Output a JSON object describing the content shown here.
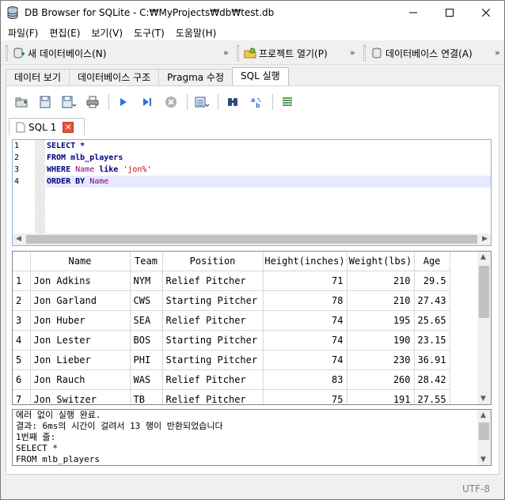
{
  "window": {
    "title": "DB Browser for SQLite - C:₩MyProjects₩db₩test.db"
  },
  "menu": [
    "파일(F)",
    "편집(E)",
    "보기(V)",
    "도구(T)",
    "도움말(H)"
  ],
  "toolbar": {
    "new_db": "새 데이터베이스(N)",
    "open_project": "프로젝트 열기(P)",
    "db_connect": "데이터베이스 연결(A)"
  },
  "tabs": [
    "데이터 보기",
    "데이터베이스 구조",
    "Pragma 수정",
    "SQL 실행"
  ],
  "active_tab": "SQL 실행",
  "sql_tab": {
    "label": "SQL 1"
  },
  "editor": {
    "line_numbers": [
      "1",
      "2",
      "3",
      "4"
    ],
    "lines": [
      [
        {
          "t": "SELECT",
          "c": "kw"
        },
        {
          "t": " *",
          "c": "kw"
        }
      ],
      [
        {
          "t": "FROM",
          "c": "kw"
        },
        {
          "t": " mlb_players",
          "c": "kw"
        }
      ],
      [
        {
          "t": "WHERE",
          "c": "kw"
        },
        {
          "t": " Name",
          "c": "id"
        },
        {
          "t": " like",
          "c": "kw"
        },
        {
          "t": " 'jon%'",
          "c": "str"
        }
      ],
      [
        {
          "t": "ORDER BY",
          "c": "kw"
        },
        {
          "t": " Name",
          "c": "id"
        }
      ]
    ]
  },
  "results": {
    "columns": [
      "Name",
      "Team",
      "Position",
      "Height(inches)",
      "Weight(lbs)",
      "Age"
    ],
    "rows": [
      [
        "1",
        "Jon Adkins",
        "NYM",
        "Relief Pitcher",
        "71",
        "210",
        "29.5"
      ],
      [
        "2",
        "Jon Garland",
        "CWS",
        "Starting Pitcher",
        "78",
        "210",
        "27.43"
      ],
      [
        "3",
        "Jon Huber",
        "SEA",
        "Relief Pitcher",
        "74",
        "195",
        "25.65"
      ],
      [
        "4",
        "Jon Lester",
        "BOS",
        "Starting Pitcher",
        "74",
        "190",
        "23.15"
      ],
      [
        "5",
        "Jon Lieber",
        "PHI",
        "Starting Pitcher",
        "74",
        "230",
        "36.91"
      ],
      [
        "6",
        "Jon Rauch",
        "WAS",
        "Relief Pitcher",
        "83",
        "260",
        "28.42"
      ],
      [
        "7",
        "Jon Switzer",
        "TB",
        "Relief Pitcher",
        "75",
        "191",
        "27.55"
      ]
    ]
  },
  "messages": [
    "에러 없이 실행 완료.",
    "결과: 6ms의 시간이 걸려서 13 행이 반환되었습니다",
    "1번째 줄:",
    "SELECT *",
    "FROM mlb_players"
  ],
  "status": {
    "encoding": "UTF-8"
  },
  "colors": {
    "accent": "#3875d7",
    "editor_border": "#7eb4ea",
    "keyword": "#00007f",
    "identifier": "#7f007f",
    "string": "#c00000"
  }
}
